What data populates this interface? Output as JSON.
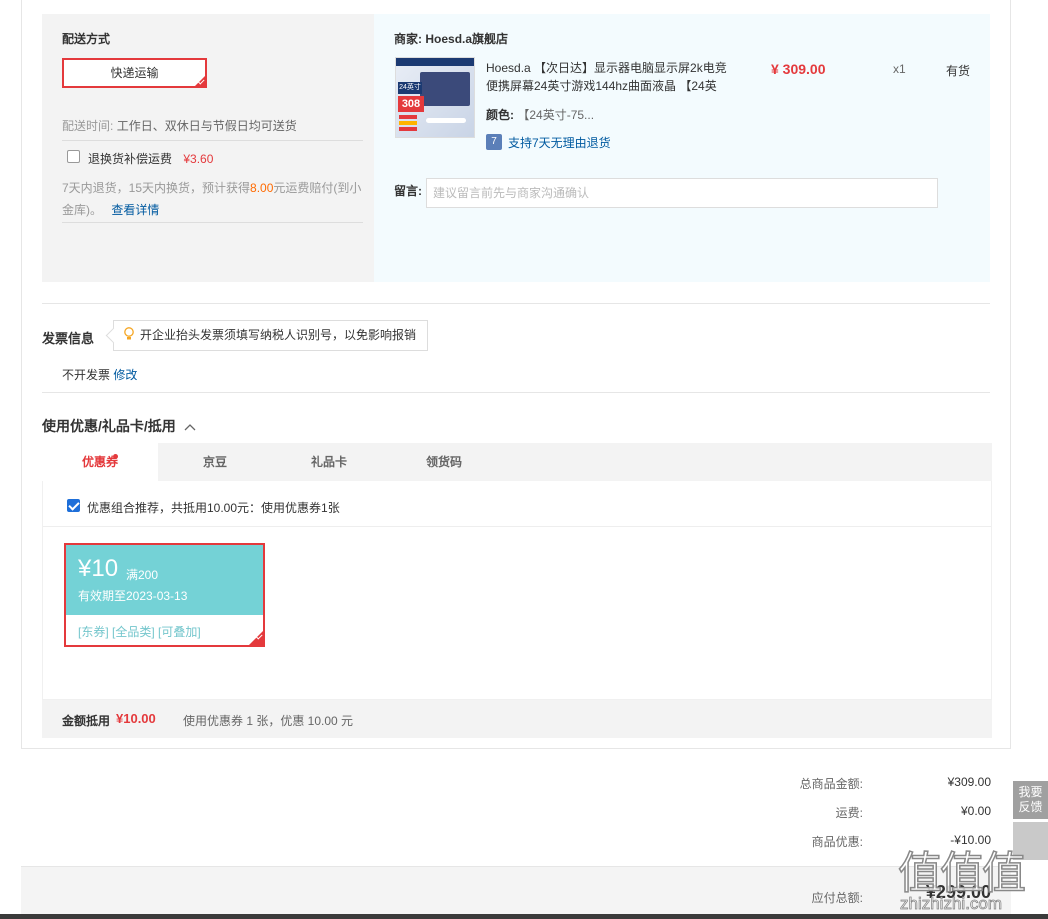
{
  "delivery": {
    "label": "配送方式",
    "method_button": "快递运输",
    "time_label": "配送时间:",
    "time_value": "工作日、双休日与节假日均可送货",
    "insurance_label": "退换货补偿运费",
    "insurance_price": "¥3.60",
    "insurance_desc_1": "7天内退货，15天内换货，预计获得",
    "insurance_amount": "8.00",
    "insurance_desc_2": "元运费赔付(到小金库)。",
    "insurance_link": "查看详情"
  },
  "shop": {
    "merchant_label": "商家:",
    "merchant_name": "Hoesd.a旗舰店",
    "product_title": "Hoesd.a 【次日达】显示器电脑显示屏2k电竞便携屏幕24英寸游戏144hz曲面液晶 【24英",
    "price": "¥ 309.00",
    "qty": "x1",
    "stock": "有货",
    "color_label": "颜色:",
    "color_value": "【24英寸-75...",
    "return_policy": "支持7天无理由退货",
    "return_icon_text": "7",
    "thumb_tag": "24英寸",
    "thumb_price": "308",
    "memo_label": "留言:",
    "memo_placeholder": "建议留言前先与商家沟通确认"
  },
  "invoice": {
    "label": "发票信息",
    "tip": "开企业抬头发票须填写纳税人识别号，以免影响报销",
    "status": "不开发票",
    "edit_link": "修改"
  },
  "discount": {
    "section_title": "使用优惠/礼品卡/抵用",
    "tabs": [
      "优惠券",
      "京豆",
      "礼品卡",
      "领货码"
    ],
    "active_tab": 0,
    "recommend_text": "优惠组合推荐，共抵用10.00元：使用优惠券1张",
    "coupon": {
      "amount": "¥10",
      "condition": "满200",
      "expiry": "有效期至2023-03-13",
      "tags": "[东券] [全品类] [可叠加]"
    },
    "summary_label": "金额抵用",
    "summary_amount": "¥10.00",
    "summary_detail": "使用优惠券 1 张，优惠 10.00 元"
  },
  "totals": {
    "goods_label": "总商品金额:",
    "goods_value": "¥309.00",
    "shipping_label": "运费:",
    "shipping_value": "¥0.00",
    "discount_label": "商品优惠:",
    "discount_value": "-¥10.00",
    "payable_label": "应付总额:",
    "payable_value": "¥299.00"
  },
  "sidebar": {
    "feedback": "我要反馈"
  },
  "watermark": {
    "text": "值值值",
    "url": "zhizhizhi.com"
  },
  "colors": {
    "accent_red": "#e4393c",
    "link_blue": "#005aa0",
    "coupon_teal": "#74d2d6"
  }
}
